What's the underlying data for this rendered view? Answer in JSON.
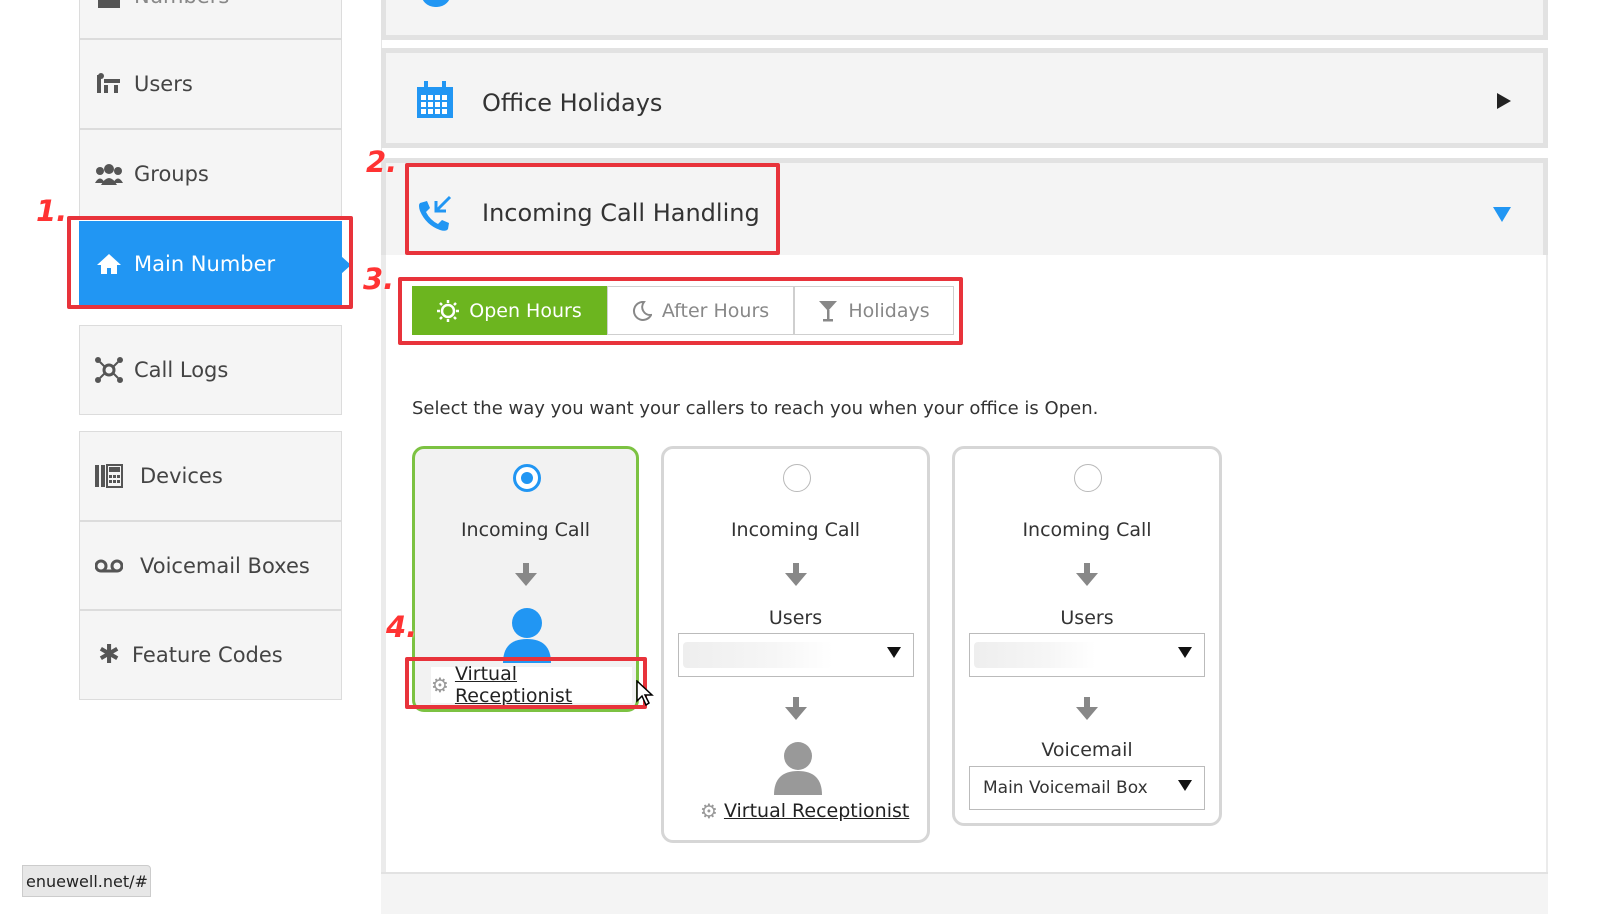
{
  "sidebar": {
    "items": [
      {
        "label": "Numbers",
        "icon": "numbers-icon"
      },
      {
        "label": "Users",
        "icon": "users-icon"
      },
      {
        "label": "Groups",
        "icon": "groups-icon"
      },
      {
        "label": "Main Number",
        "icon": "home-icon",
        "active": true
      },
      {
        "label": "Call Logs",
        "icon": "call-logs-icon"
      },
      {
        "label": "Devices",
        "icon": "devices-icon"
      },
      {
        "label": "Voicemail Boxes",
        "icon": "voicemail-icon"
      },
      {
        "label": "Feature Codes",
        "icon": "asterisk-icon"
      }
    ]
  },
  "panels": {
    "office_holidays": {
      "title": "Office Holidays",
      "icon": "calendar-icon"
    },
    "incoming_call_handling": {
      "title": "Incoming Call Handling",
      "icon": "incoming-call-icon"
    }
  },
  "tabs": [
    {
      "label": "Open Hours",
      "icon": "sun-icon",
      "active": true
    },
    {
      "label": "After Hours",
      "icon": "moon-icon"
    },
    {
      "label": "Holidays",
      "icon": "cocktail-icon"
    }
  ],
  "instruction": "Select the way you want your callers to reach you when your office is Open.",
  "options": [
    {
      "selected": true,
      "title": "Incoming Call",
      "link": "Virtual Receptionist"
    },
    {
      "selected": false,
      "title": "Incoming Call",
      "step_label": "Users",
      "link": "Virtual Receptionist"
    },
    {
      "selected": false,
      "title": "Incoming Call",
      "step_label": "Users",
      "step2_label": "Voicemail",
      "voicemail_select": "Main Voicemail Box"
    }
  ],
  "annotations": [
    "1.",
    "2.",
    "3.",
    "4."
  ],
  "status_url": "enuewell.net/#",
  "colors": {
    "primary": "#2196f3",
    "green": "#6cb51f",
    "annotation_red": "#e8333b"
  }
}
